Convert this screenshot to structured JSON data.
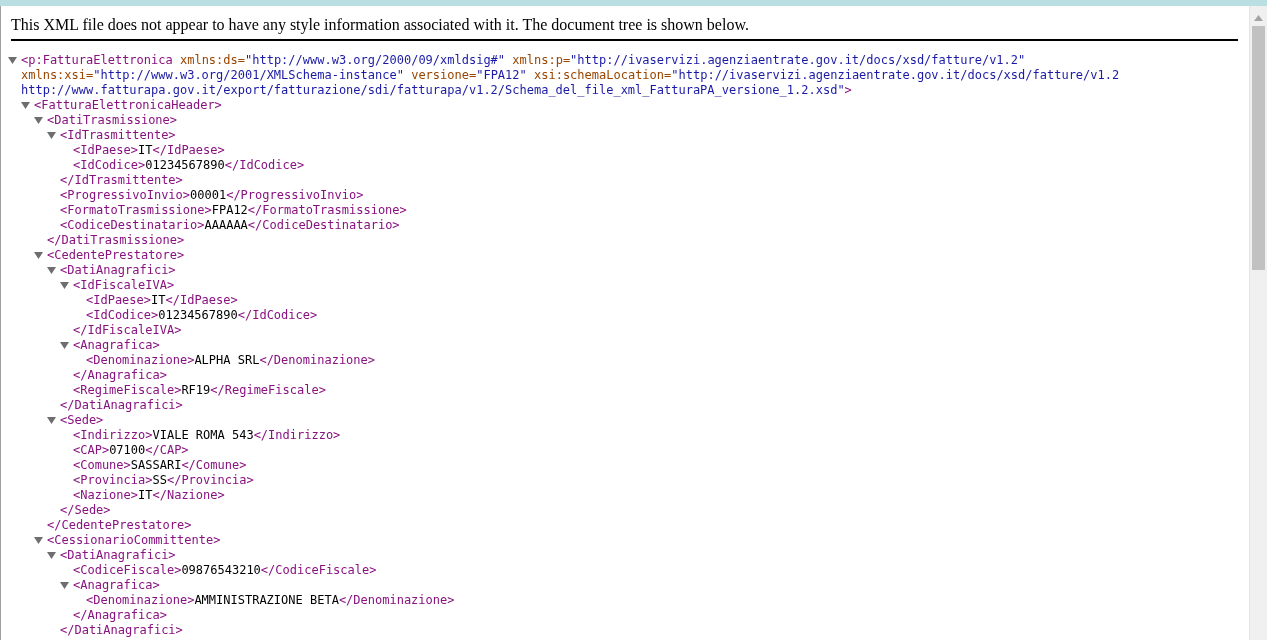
{
  "notice": "This XML file does not appear to have any style information associated with it. The document tree is shown below.",
  "tree": {
    "kind": "element",
    "open": "<p:FatturaElettronica",
    "attributes": [
      {
        "name": "xmlns:ds=",
        "value": "\"http://www.w3.org/2000/09/xmldsig#\""
      },
      {
        "name": "xmlns:p=",
        "value": "\"http://ivaservizi.agenziaentrate.gov.it/docs/xsd/fatture/v1.2\""
      },
      {
        "name": "xmlns:xsi=",
        "value": "\"http://www.w3.org/2001/XMLSchema-instance\""
      },
      {
        "name": "versione=",
        "value": "\"FPA12\""
      },
      {
        "name": "xsi:schemaLocation=",
        "value": "\"http://ivaservizi.agenziaentrate.gov.it/docs/xsd/fatture/v1.2 http://www.fatturapa.gov.it/export/fatturazione/sdi/fatturapa/v1.2/Schema_del_file_xml_FatturaPA_versione_1.2.xsd\""
      }
    ],
    "open_end": ">",
    "expanded": true,
    "children": [
      {
        "kind": "element",
        "open": "<FatturaElettronicaHeader>",
        "expanded": true,
        "children": [
          {
            "kind": "element",
            "open": "<DatiTrasmissione>",
            "expanded": true,
            "children": [
              {
                "kind": "element",
                "open": "<IdTrasmittente>",
                "expanded": true,
                "children": [
                  {
                    "kind": "leaf",
                    "open": "<IdPaese>",
                    "text": "IT",
                    "close": "</IdPaese>"
                  },
                  {
                    "kind": "leaf",
                    "open": "<IdCodice>",
                    "text": "01234567890",
                    "close": "</IdCodice>"
                  }
                ],
                "close": "</IdTrasmittente>"
              },
              {
                "kind": "leaf",
                "open": "<ProgressivoInvio>",
                "text": "00001",
                "close": "</ProgressivoInvio>"
              },
              {
                "kind": "leaf",
                "open": "<FormatoTrasmissione>",
                "text": "FPA12",
                "close": "</FormatoTrasmissione>"
              },
              {
                "kind": "leaf",
                "open": "<CodiceDestinatario>",
                "text": "AAAAAA",
                "close": "</CodiceDestinatario>"
              }
            ],
            "close": "</DatiTrasmissione>"
          },
          {
            "kind": "element",
            "open": "<CedentePrestatore>",
            "expanded": true,
            "children": [
              {
                "kind": "element",
                "open": "<DatiAnagrafici>",
                "expanded": true,
                "children": [
                  {
                    "kind": "element",
                    "open": "<IdFiscaleIVA>",
                    "expanded": true,
                    "children": [
                      {
                        "kind": "leaf",
                        "open": "<IdPaese>",
                        "text": "IT",
                        "close": "</IdPaese>"
                      },
                      {
                        "kind": "leaf",
                        "open": "<IdCodice>",
                        "text": "01234567890",
                        "close": "</IdCodice>"
                      }
                    ],
                    "close": "</IdFiscaleIVA>"
                  },
                  {
                    "kind": "element",
                    "open": "<Anagrafica>",
                    "expanded": true,
                    "children": [
                      {
                        "kind": "leaf",
                        "open": "<Denominazione>",
                        "text": "ALPHA SRL",
                        "close": "</Denominazione>"
                      }
                    ],
                    "close": "</Anagrafica>"
                  },
                  {
                    "kind": "leaf",
                    "open": "<RegimeFiscale>",
                    "text": "RF19",
                    "close": "</RegimeFiscale>"
                  }
                ],
                "close": "</DatiAnagrafici>"
              },
              {
                "kind": "element",
                "open": "<Sede>",
                "expanded": true,
                "children": [
                  {
                    "kind": "leaf",
                    "open": "<Indirizzo>",
                    "text": "VIALE ROMA 543",
                    "close": "</Indirizzo>"
                  },
                  {
                    "kind": "leaf",
                    "open": "<CAP>",
                    "text": "07100",
                    "close": "</CAP>"
                  },
                  {
                    "kind": "leaf",
                    "open": "<Comune>",
                    "text": "SASSARI",
                    "close": "</Comune>"
                  },
                  {
                    "kind": "leaf",
                    "open": "<Provincia>",
                    "text": "SS",
                    "close": "</Provincia>"
                  },
                  {
                    "kind": "leaf",
                    "open": "<Nazione>",
                    "text": "IT",
                    "close": "</Nazione>"
                  }
                ],
                "close": "</Sede>"
              }
            ],
            "close": "</CedentePrestatore>"
          },
          {
            "kind": "element",
            "open": "<CessionarioCommittente>",
            "expanded": true,
            "children": [
              {
                "kind": "element",
                "open": "<DatiAnagrafici>",
                "expanded": true,
                "children": [
                  {
                    "kind": "leaf",
                    "open": "<CodiceFiscale>",
                    "text": "09876543210",
                    "close": "</CodiceFiscale>"
                  },
                  {
                    "kind": "element",
                    "open": "<Anagrafica>",
                    "expanded": true,
                    "children": [
                      {
                        "kind": "leaf",
                        "open": "<Denominazione>",
                        "text": "AMMINISTRAZIONE BETA",
                        "close": "</Denominazione>"
                      }
                    ],
                    "close": "</Anagrafica>"
                  }
                ],
                "close": "</DatiAnagrafici>"
              }
            ]
          }
        ]
      }
    ]
  }
}
